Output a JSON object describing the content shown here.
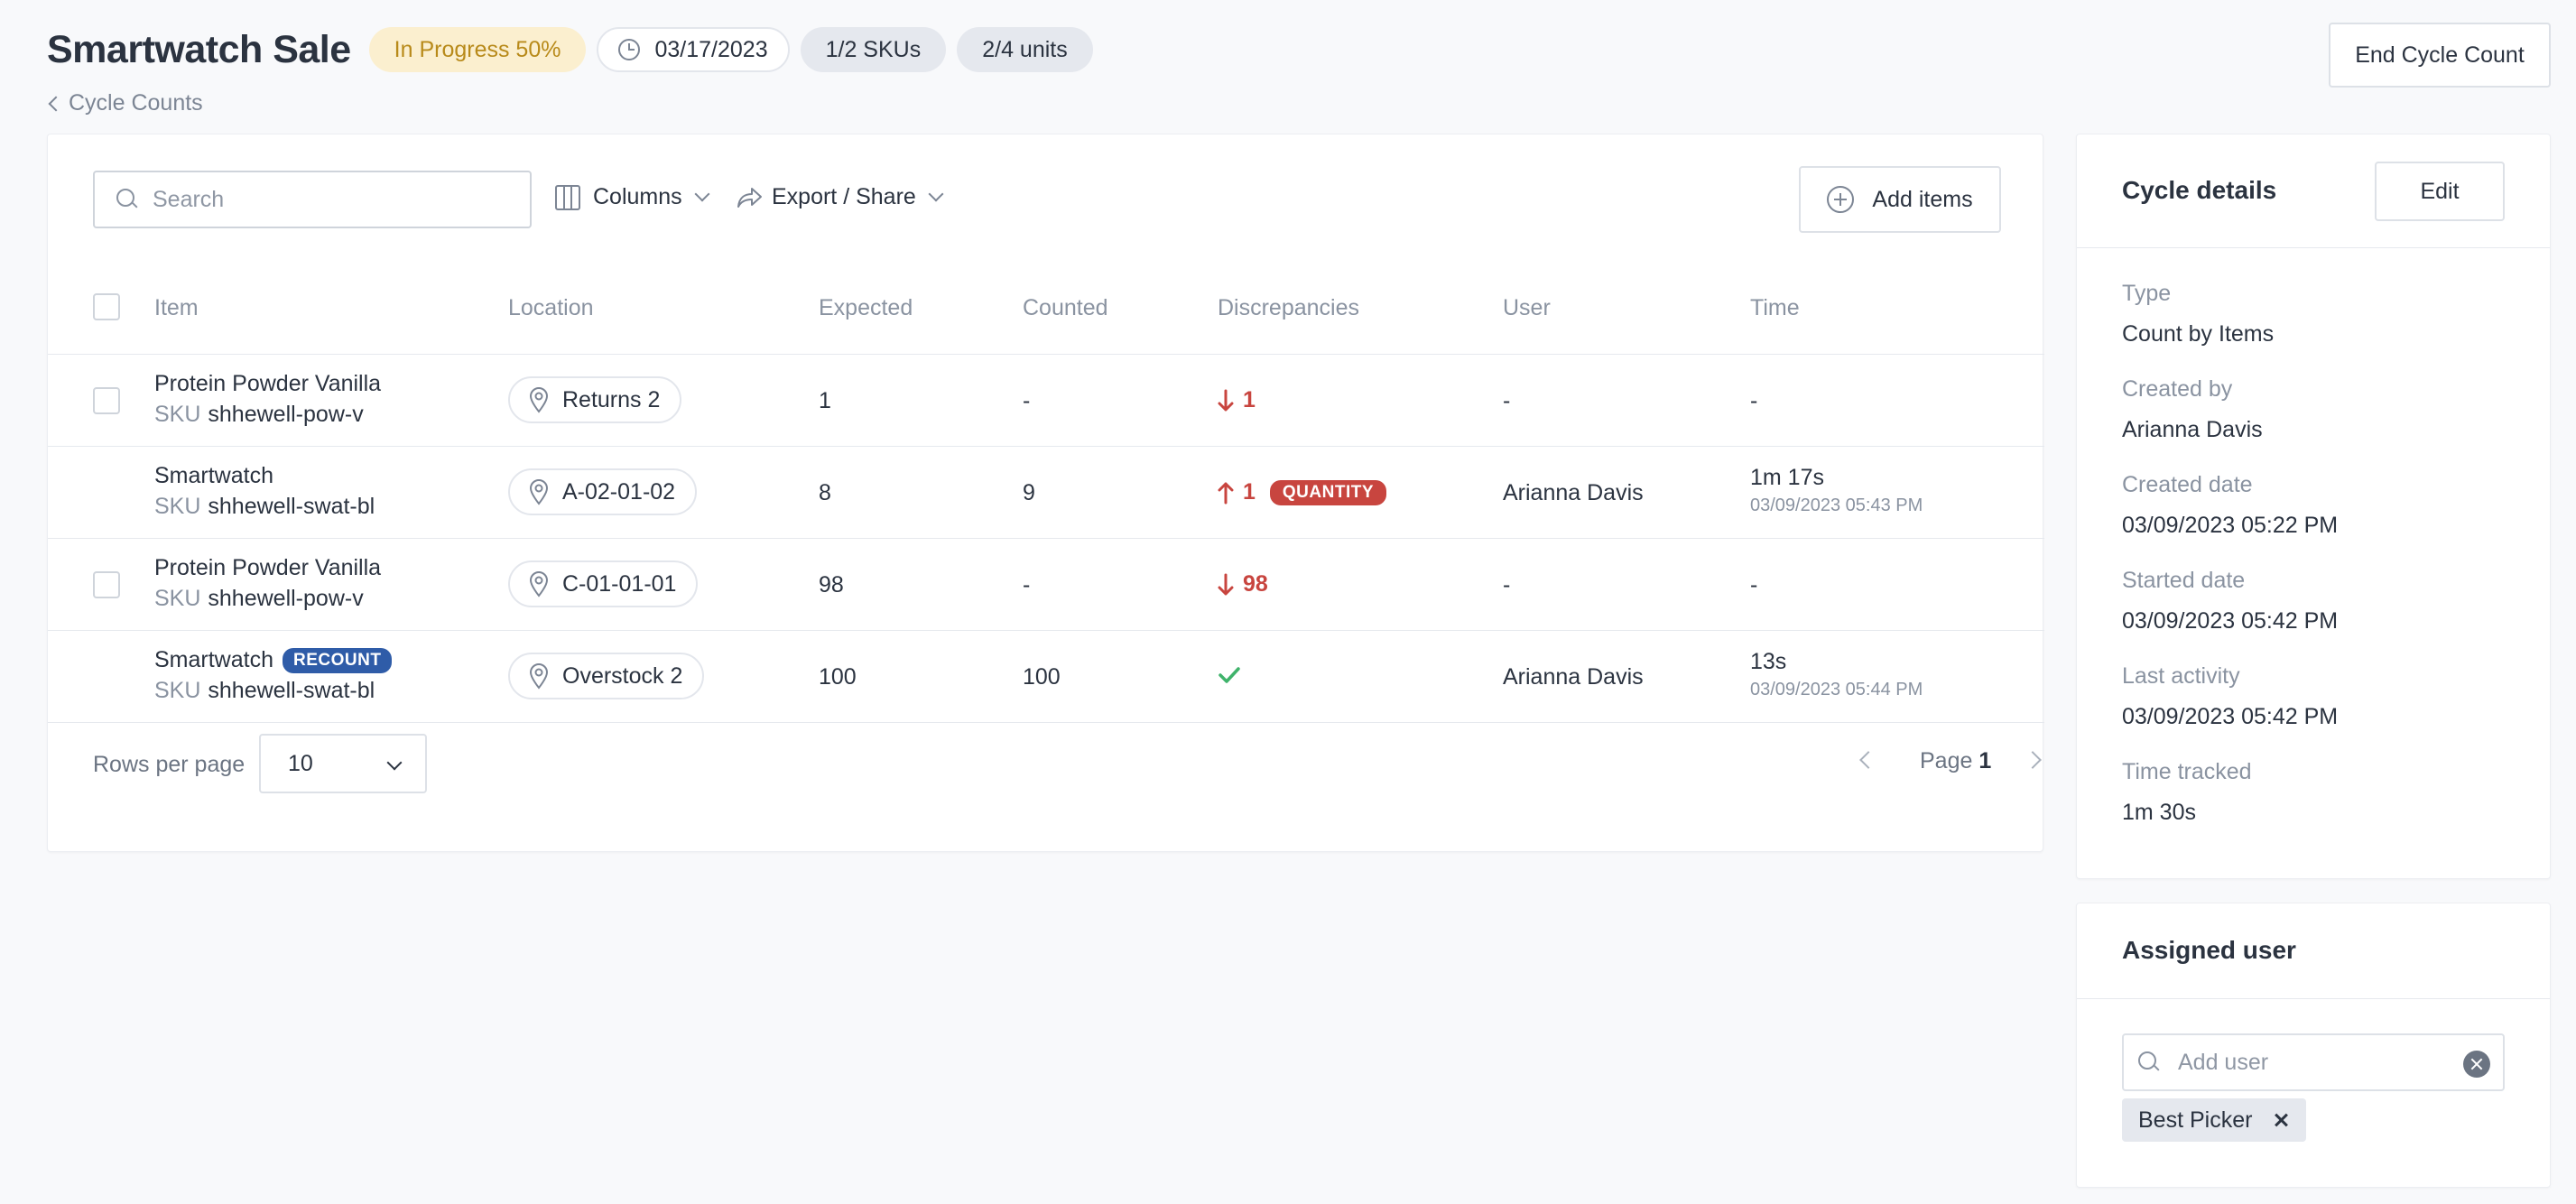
{
  "header": {
    "title": "Smartwatch Sale",
    "progress": "In Progress 50%",
    "date": "03/17/2023",
    "skus": "1/2 SKUs",
    "units": "2/4 units",
    "end_button": "End Cycle Count",
    "breadcrumb": "Cycle Counts"
  },
  "toolbar": {
    "search_placeholder": "Search",
    "columns": "Columns",
    "export": "Export / Share",
    "add_items": "Add items"
  },
  "table": {
    "headers": [
      "Item",
      "Location",
      "Expected",
      "Counted",
      "Discrepancies",
      "User",
      "Time"
    ],
    "sku_label": "SKU",
    "rows": [
      {
        "name": "Protein Powder Vanilla",
        "sku": "shhewell-pow-v",
        "location": "Returns 2",
        "expected": "1",
        "counted": "-",
        "disc_direction": "down",
        "disc_value": "1",
        "user": "-",
        "time": "-",
        "time_sub": ""
      },
      {
        "name": "Smartwatch",
        "sku": "shhewell-swat-bl",
        "location": "A-02-01-02",
        "expected": "8",
        "counted": "9",
        "disc_direction": "up",
        "disc_value": "1",
        "disc_badge": "QUANTITY",
        "user": "Arianna Davis",
        "time": "1m 17s",
        "time_sub": "03/09/2023 05:43 PM"
      },
      {
        "name": "Protein Powder Vanilla",
        "sku": "shhewell-pow-v",
        "location": "C-01-01-01",
        "expected": "98",
        "counted": "-",
        "disc_direction": "down",
        "disc_value": "98",
        "user": "-",
        "time": "-",
        "time_sub": ""
      },
      {
        "name": "Smartwatch",
        "name_badge": "RECOUNT",
        "sku": "shhewell-swat-bl",
        "location": "Overstock 2",
        "expected": "100",
        "counted": "100",
        "disc_direction": "match",
        "disc_value": "",
        "user": "Arianna Davis",
        "time": "13s",
        "time_sub": "03/09/2023 05:44 PM"
      }
    ]
  },
  "pagination": {
    "rows_per_page_label": "Rows per page",
    "rows_per_page": "10",
    "page_label": "Page",
    "page": "1"
  },
  "details": {
    "title": "Cycle details",
    "edit": "Edit",
    "fields": [
      {
        "label": "Type",
        "value": "Count by Items"
      },
      {
        "label": "Created by",
        "value": "Arianna Davis"
      },
      {
        "label": "Created date",
        "value": "03/09/2023 05:22 PM"
      },
      {
        "label": "Started date",
        "value": "03/09/2023 05:42 PM"
      },
      {
        "label": "Last activity",
        "value": "03/09/2023 05:42 PM"
      },
      {
        "label": "Time tracked",
        "value": "1m 30s"
      }
    ]
  },
  "assigned": {
    "title": "Assigned user",
    "placeholder": "Add user",
    "chip": "Best Picker"
  },
  "colors": {
    "accent_red": "#c8453f",
    "accent_blue": "#2f5ca8",
    "success_green": "#3fb36b",
    "progress_bg": "#fbefcf",
    "progress_text": "#b88a1a"
  }
}
